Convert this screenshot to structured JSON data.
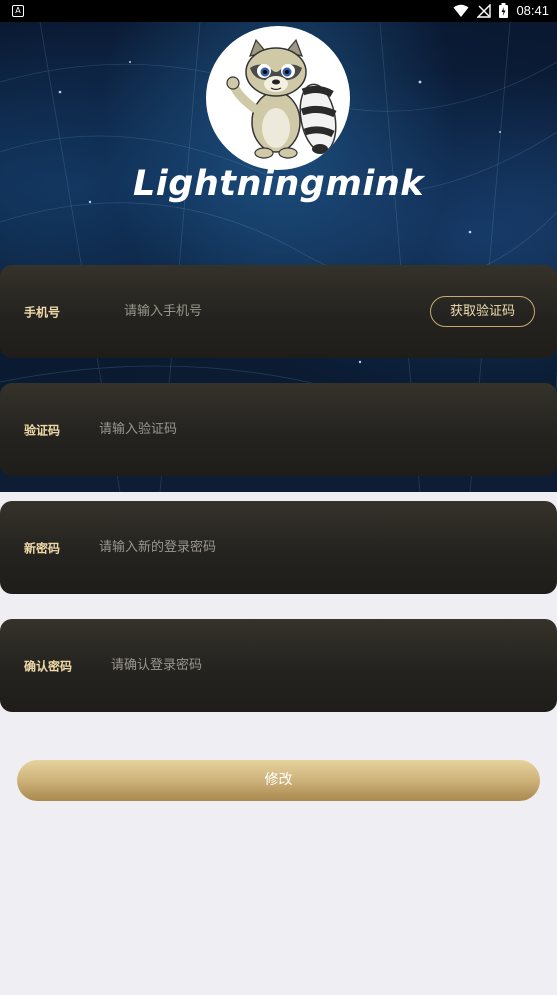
{
  "status_bar": {
    "left_icon": "A",
    "time": "08:41",
    "icons": [
      "wifi-icon",
      "no-signal-icon",
      "battery-charging-icon"
    ]
  },
  "header": {
    "logo": "raccoon-mascot",
    "brand": "Lightningmink"
  },
  "form": {
    "phone": {
      "label": "手机号",
      "placeholder": "请输入手机号",
      "value": ""
    },
    "get_code_button": "获取验证码",
    "code": {
      "label": "验证码",
      "placeholder": "请输入验证码",
      "value": ""
    },
    "new_password": {
      "label": "新密码",
      "placeholder": "请输入新的登录密码",
      "value": ""
    },
    "confirm_password": {
      "label": "确认密码",
      "placeholder": "请确认登录密码",
      "value": ""
    },
    "submit_button": "修改"
  },
  "colors": {
    "accent_gold": "#d1b57d",
    "card_dark": "#25231f",
    "label_gold": "#efd9a8",
    "page_bg": "#efeef3"
  }
}
